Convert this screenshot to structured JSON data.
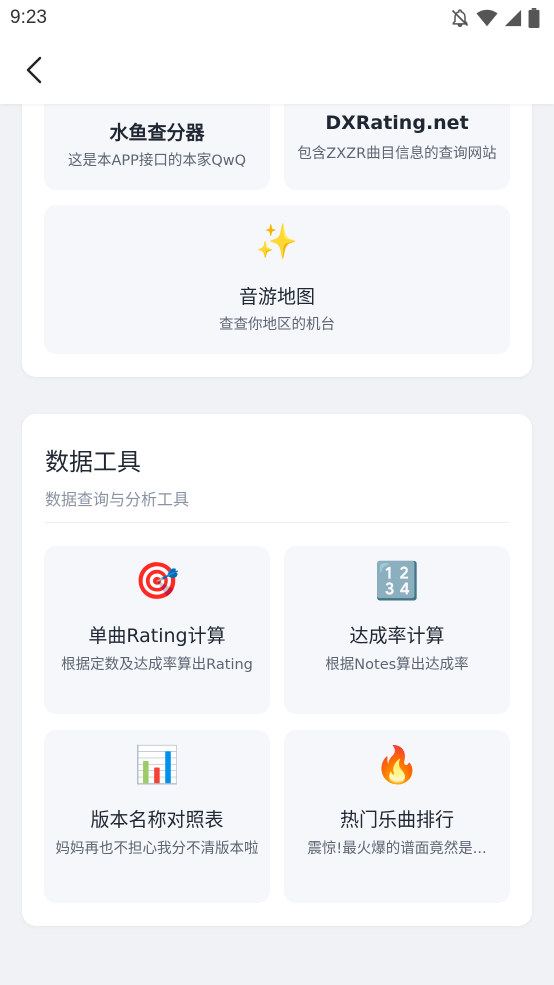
{
  "status": {
    "time": "9:23"
  },
  "top_tiles": [
    {
      "title": "水鱼查分器",
      "desc": "这是本APP接口的本家QwQ"
    },
    {
      "title": "DXRating.net",
      "desc": "包含ZXZR曲目信息的查询网站"
    }
  ],
  "map_tile": {
    "icon": "✨",
    "title": "音游地图",
    "desc": "查查你地区的机台"
  },
  "data_tools": {
    "title": "数据工具",
    "subtitle": "数据查询与分析工具",
    "tiles": [
      {
        "icon": "🎯",
        "icon_name": "target-icon",
        "title": "单曲Rating计算",
        "desc": "根据定数及达成率算出Rating"
      },
      {
        "icon": "🔢",
        "icon_name": "numbers-icon",
        "title": "达成率计算",
        "desc": "根据Notes算出达成率"
      },
      {
        "icon": "📊",
        "icon_name": "bar-chart-icon",
        "title": "版本名称对照表",
        "desc": "妈妈再也不担心我分不清版本啦"
      },
      {
        "icon": "🔥",
        "icon_name": "fire-icon",
        "title": "热门乐曲排行",
        "desc": "震惊!最火爆的谱面竟然是..."
      }
    ]
  }
}
